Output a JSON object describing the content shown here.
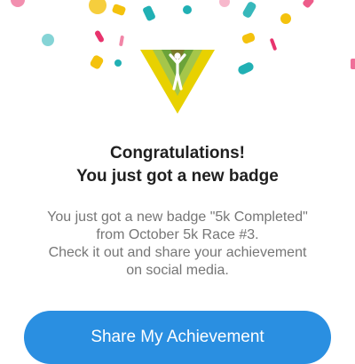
{
  "dialog": {
    "title_line1": "Congratulations!",
    "title_line2": "You just got a new badge",
    "message_line1": "You just got a new badge \"5k Completed\"",
    "message_line2": "from October 5k Race #3.",
    "message_line3": "Check it out and share your achievement",
    "message_line4": "on social media.",
    "share_button_label": "Share My Achievement"
  },
  "badge": {
    "icon": "runner-badge-icon",
    "colors": {
      "outer": "#e8d100",
      "inner": "#6ba33a",
      "core": "#7a7a2a"
    }
  },
  "colors": {
    "accent": "#2a8fe1",
    "confetti_teal": "#21b0b4",
    "confetti_yellow": "#f4c20d",
    "confetti_pink": "#e8336d"
  }
}
